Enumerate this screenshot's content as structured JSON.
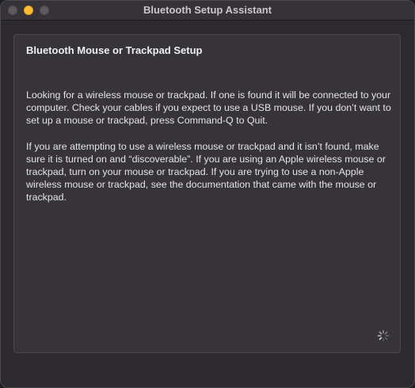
{
  "window": {
    "title": "Bluetooth Setup Assistant"
  },
  "panel": {
    "heading": "Bluetooth Mouse or Trackpad Setup",
    "paragraph_1": "Looking for a wireless mouse or trackpad. If one is found it will be connected to your computer. Check your cables if you expect to use a USB mouse. If you don’t want to set up a mouse or trackpad, press Command-Q to Quit.",
    "paragraph_2": "If you are attempting to use a wireless mouse or trackpad and it isn’t found, make sure it is turned on and “discoverable”. If you are using an Apple wireless mouse or trackpad, turn on your mouse or trackpad. If you are trying to use a non-Apple wireless mouse or trackpad, see the documentation that came with the mouse or trackpad."
  },
  "icons": {
    "close": "close-button",
    "minimize": "minimize-button",
    "zoom": "zoom-button",
    "progress": "spinner-icon"
  },
  "colors": {
    "window_background": "#2c2a2f",
    "panel_background": "#363439",
    "minimize_yellow": "#febc2e"
  }
}
